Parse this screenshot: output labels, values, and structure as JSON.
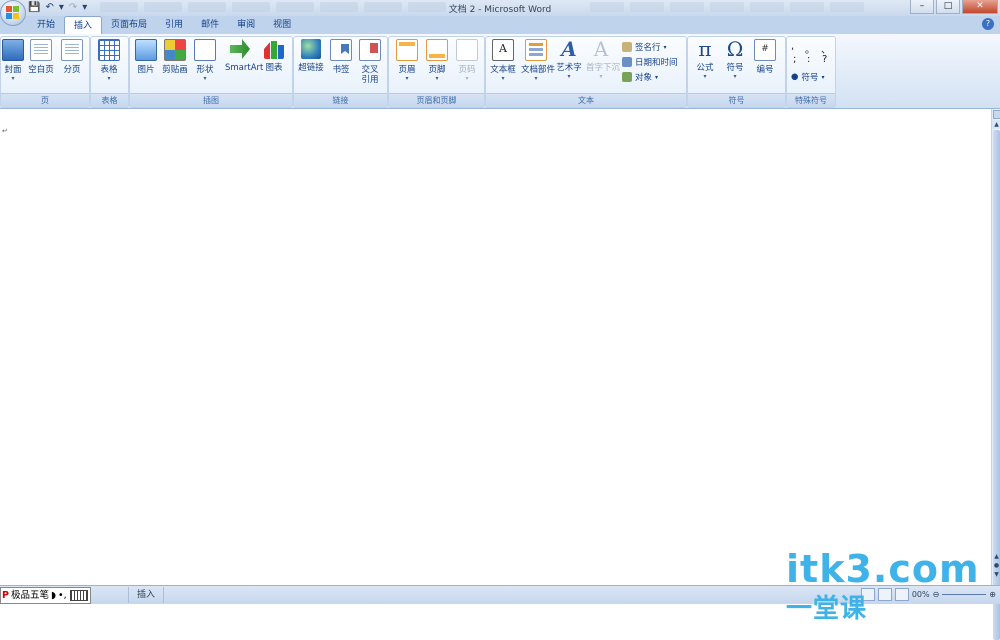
{
  "window": {
    "title": "文档 2 - Microsoft Word"
  },
  "quick_access": {
    "save_icon": "save-icon",
    "undo_icon": "undo-icon",
    "redo_icon": "redo-icon",
    "customize_icon": "chevron-down-icon"
  },
  "window_controls": {
    "minimize": "–",
    "maximize": "□",
    "close": "✕"
  },
  "tabs": [
    {
      "label": "开始"
    },
    {
      "label": "插入",
      "active": true
    },
    {
      "label": "页面布局"
    },
    {
      "label": "引用"
    },
    {
      "label": "邮件"
    },
    {
      "label": "审阅"
    },
    {
      "label": "视图"
    }
  ],
  "groups": {
    "pages": {
      "label": "页",
      "buttons": [
        "封面",
        "空白页",
        "分页"
      ]
    },
    "tables": {
      "label": "表格",
      "buttons": [
        "表格"
      ]
    },
    "illustrations": {
      "label": "插图",
      "buttons": [
        "图片",
        "剪贴画",
        "形状",
        "SmartArt",
        "图表"
      ]
    },
    "links": {
      "label": "链接",
      "buttons": [
        "超链接",
        "书签",
        "交叉",
        "引用"
      ]
    },
    "header_footer": {
      "label": "页眉和页脚",
      "buttons": [
        "页眉",
        "页脚",
        "页码"
      ]
    },
    "text": {
      "label": "文本",
      "buttons": [
        "文本框",
        "文档部件",
        "艺术字",
        "首字下沉"
      ],
      "small_buttons": [
        "签名行",
        "日期和时间",
        "对象"
      ],
      "textbox_glyph": "A",
      "wordart_glyph": "A",
      "dropcap_glyph": "A"
    },
    "symbols": {
      "label": "符号",
      "buttons": [
        "公式",
        "符号",
        "编号"
      ],
      "equation_glyph": "π",
      "symbol_glyph": "Ω",
      "number_glyph": "#"
    },
    "special_symbols": {
      "label": "特殊符号",
      "chars": [
        ",",
        "。",
        "、",
        ";",
        ":",
        "?"
      ],
      "button": "符号"
    }
  },
  "document": {
    "paragraph_mark": "↵"
  },
  "status_bar": {
    "ime": {
      "logo": "P",
      "name": "极品五笔",
      "half_moon": "◗",
      "punct": "•,",
      "keyboard_icon": "keyboard-icon"
    },
    "mode": "插入",
    "zoom_partial": "00%"
  },
  "watermark": {
    "latin": "itk3.com",
    "cn": "一堂课"
  }
}
